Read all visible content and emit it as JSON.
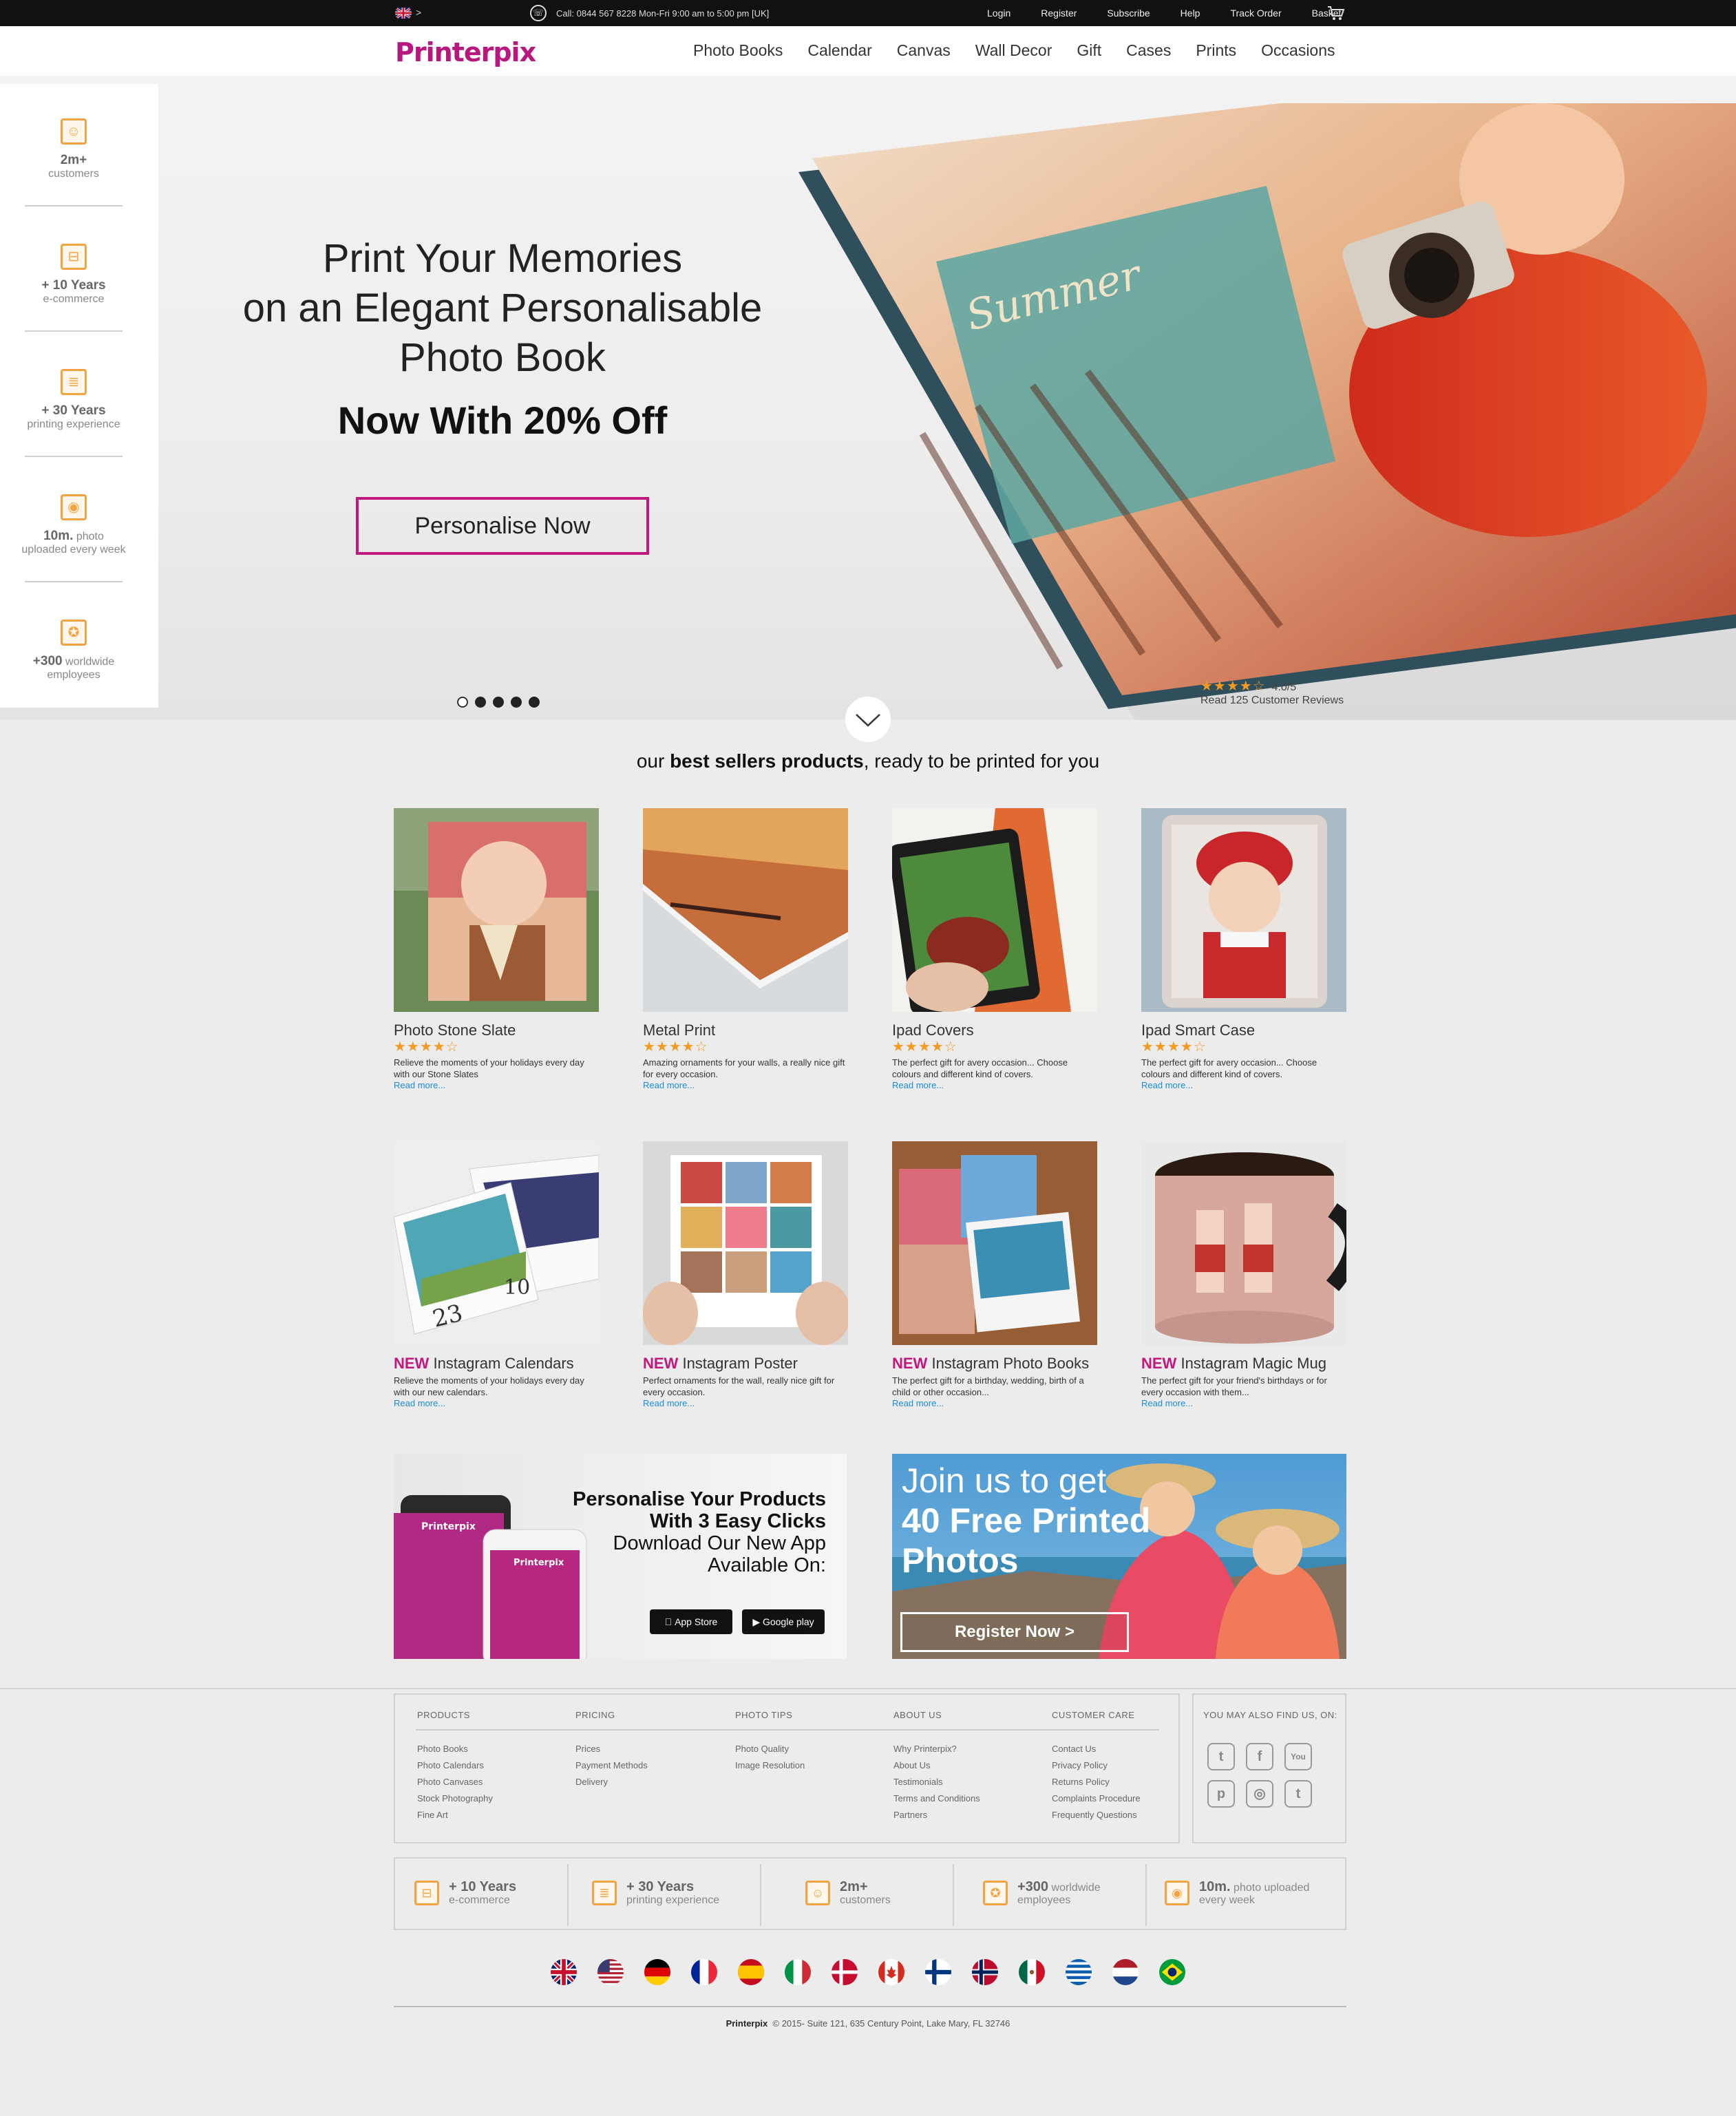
{
  "topbar": {
    "arrow": ">",
    "phone": "Call: 0844 567 8228 Mon-Fri 9:00 am to 5:00 pm [UK]",
    "links": [
      "Login",
      "Register",
      "Subscribe",
      "Help",
      "Track Order",
      "Basket"
    ]
  },
  "header": {
    "logo": "Printerpix",
    "nav": [
      "Photo Books",
      "Calendar",
      "Canvas",
      "Wall Decor",
      "Gift",
      "Cases",
      "Prints",
      "Occasions"
    ]
  },
  "hero": {
    "title_lines": [
      "Print Your Memories",
      "on an Elegant Personalisable",
      "Photo Book"
    ],
    "subtitle": "Now With 20% Off",
    "cta": "Personalise Now",
    "rating": "4.0/5",
    "rating_value": 4,
    "reviews": "Read 125 Customer Reviews",
    "slides": 5,
    "active_slide": 1
  },
  "side_stats": [
    {
      "big": "2m+",
      "small": "customers",
      "icon": "people-icon"
    },
    {
      "big": "+ 10 Years",
      "small": "e-commerce",
      "icon": "cart-icon"
    },
    {
      "big": "+ 30 Years",
      "small": "printing experience",
      "icon": "document-icon"
    },
    {
      "big": "10m.",
      "small_inline": "photo",
      "small": "uploaded every week",
      "icon": "camera-icon"
    },
    {
      "big": "+300",
      "small_inline": "worldwide",
      "small": "employees",
      "icon": "badge-icon"
    }
  ],
  "bestsellers": {
    "title_pre": "our ",
    "title_bold": "best sellers products",
    "title_post": ", ready to be printed for you",
    "products": [
      {
        "new": "",
        "name": "Photo Stone Slate",
        "rating": 4,
        "desc": "Relieve the moments of your holidays every day with our Stone Slates",
        "more": "Read more..."
      },
      {
        "new": "",
        "name": "Metal Print",
        "rating": 4,
        "desc": "Amazing ornaments for your walls, a really nice gift for every occasion.",
        "more": "Read more..."
      },
      {
        "new": "",
        "name": "Ipad Covers",
        "rating": 4,
        "desc": "The perfect gift for avery occasion... Choose colours and different kind of covers.",
        "more": "Read more..."
      },
      {
        "new": "",
        "name": "Ipad Smart Case",
        "rating": 4,
        "desc": "The perfect gift for avery occasion... Choose colours and different kind of covers.",
        "more": "Read more..."
      },
      {
        "new": "NEW",
        "name": "Instagram Calendars",
        "rating": 0,
        "desc": "Relieve the moments of your holidays every day with our new calendars.",
        "more": "Read more..."
      },
      {
        "new": "NEW",
        "name": "Instagram Poster",
        "rating": 0,
        "desc": "Perfect ornaments for the wall, really nice gift for every occasion.",
        "more": "Read more..."
      },
      {
        "new": "NEW",
        "name": "Instagram Photo Books",
        "rating": 0,
        "desc": "The perfect gift for a birthday, wedding, birth of a child or other occasion...",
        "more": "Read more..."
      },
      {
        "new": "NEW",
        "name": "Instagram Magic Mug",
        "rating": 0,
        "desc": "The perfect gift for your friend's birthdays or for every occasion with them...",
        "more": "Read more..."
      }
    ]
  },
  "promo_app": {
    "line1": "Personalise Your Products",
    "line2": "With 3 Easy Clicks",
    "line3": "Download Our New App",
    "line4": "Available On:",
    "appstore": "App Store",
    "googleplay": "Google play",
    "phone_logo": "Printerpix"
  },
  "promo_join": {
    "line1": "Join us to get",
    "line2": "40 Free Printed",
    "line3": "Photos",
    "cta": "Register Now >"
  },
  "footer": {
    "columns": [
      {
        "title": "PRODUCTS",
        "links": [
          "Photo Books",
          "Photo Calendars",
          "Photo Canvases",
          "Stock Photography",
          "Fine Art"
        ]
      },
      {
        "title": "PRICING",
        "links": [
          "Prices",
          "Payment Methods",
          "Delivery"
        ]
      },
      {
        "title": "PHOTO TIPS",
        "links": [
          "Photo Quality",
          "Image Resolution"
        ]
      },
      {
        "title": "ABOUT US",
        "links": [
          "Why Printerpix?",
          "About Us",
          "Testimonials",
          "Terms and Conditions",
          "Partners"
        ]
      },
      {
        "title": "CUSTOMER CARE",
        "links": [
          "Contact Us",
          "Privacy Policy",
          "Returns Policy",
          "Complaints Procedure",
          "Frequently Questions"
        ]
      }
    ],
    "social_title": "YOU MAY ALSO FIND US, ON:",
    "social": [
      "twitter-icon",
      "facebook-icon",
      "youtube-icon",
      "pinterest-icon",
      "instagram-icon",
      "tumblr-icon"
    ],
    "stats": [
      {
        "big": "+ 10 Years",
        "small": "e-commerce",
        "icon": "cart-icon"
      },
      {
        "big": "+ 30 Years",
        "small": "printing experience",
        "icon": "document-icon"
      },
      {
        "big": "2m+",
        "small": "customers",
        "icon": "people-icon"
      },
      {
        "big": "+300",
        "small_inline": "worldwide",
        "small": "employees",
        "icon": "badge-icon"
      },
      {
        "big": "10m.",
        "small_inline": "photo uploaded",
        "small": "every week",
        "icon": "camera-icon"
      }
    ],
    "flags": [
      "uk",
      "us",
      "de",
      "fr",
      "es",
      "it",
      "dk",
      "ca",
      "fi",
      "no",
      "mx",
      "gr",
      "nl",
      "br"
    ],
    "copyright_brand": "Printerpix",
    "copyright": "© 2015- Suite 121, 635 Century Point, Lake Mary, FL 32746"
  },
  "colors": {
    "accent": "#c2187d",
    "star": "#f39a20",
    "stat_icon": "#f5a340",
    "link": "#1a8bd8"
  }
}
